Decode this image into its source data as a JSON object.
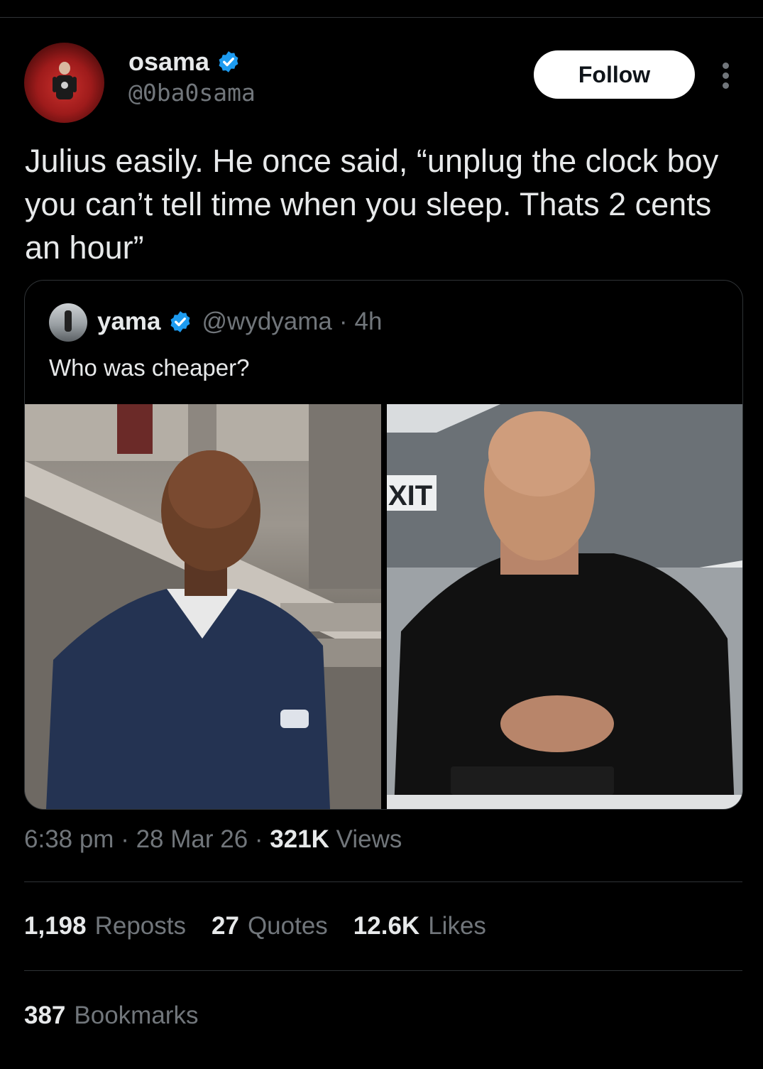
{
  "author": {
    "name": "osama",
    "handle": "@0ba0sama",
    "verified": true
  },
  "follow_label": "Follow",
  "tweet_text": "Julius easily. He once said, “unplug the clock boy you can’t tell time when you sleep. Thats 2 cents an hour”",
  "quoted": {
    "name": "yama",
    "handle": "@wydyama",
    "separator": "·",
    "time": "4h",
    "text": "Who was cheaper?",
    "image_right_sign": "XIT"
  },
  "meta": {
    "time": "6:38 pm",
    "sep1": " · ",
    "date": "28 Mar 26",
    "sep2": " · ",
    "views_count": "321K",
    "views_label": " Views"
  },
  "stats": {
    "reposts_count": "1,198",
    "reposts_label": "Reposts",
    "quotes_count": "27",
    "quotes_label": "Quotes",
    "likes_count": "12.6K",
    "likes_label": "Likes",
    "bookmarks_count": "387",
    "bookmarks_label": "Bookmarks"
  },
  "colors": {
    "background": "#000000",
    "text_primary": "#e7e9ea",
    "text_secondary": "#71767b",
    "verified_blue": "#1d9bf0",
    "divider": "#2f3336"
  }
}
